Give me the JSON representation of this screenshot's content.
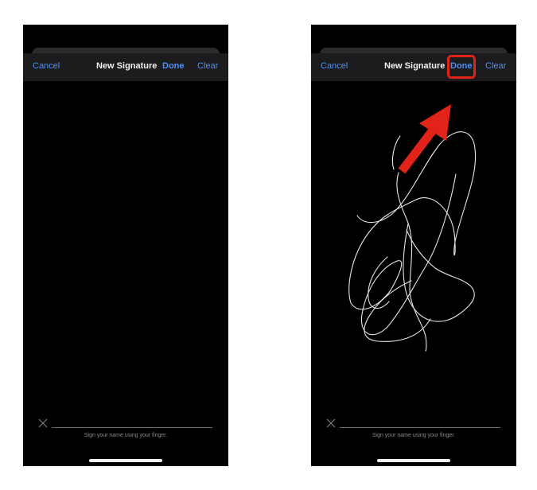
{
  "screens": [
    {
      "nav": {
        "cancel_label": "Cancel",
        "title": "New Signature",
        "done_label": "Done",
        "clear_label": "Clear"
      },
      "hint": "Sign your name using your finger."
    },
    {
      "nav": {
        "cancel_label": "Cancel",
        "title": "New Signature",
        "done_label": "Done",
        "clear_label": "Clear"
      },
      "hint": "Sign your name using your finger."
    }
  ],
  "colors": {
    "accent": "#4c8ff5",
    "highlight": "#e2231a",
    "background": "#000000"
  },
  "icons": {
    "clear_mark": "x-mark-icon",
    "annotation": "red-arrow-icon"
  }
}
